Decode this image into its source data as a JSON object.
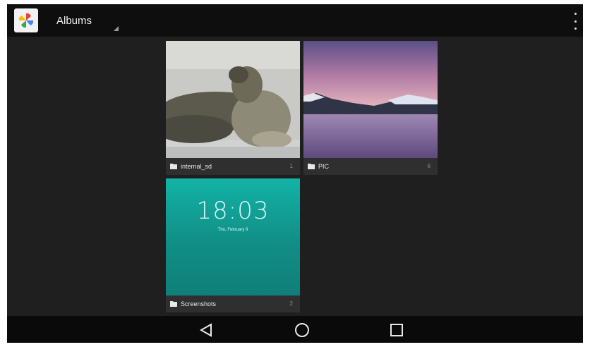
{
  "actionbar": {
    "title": "Albums",
    "app_icon": "photos-pinwheel-icon",
    "menu_icon": "overflow-menu-icon"
  },
  "albums": [
    {
      "name": "internal_sd",
      "count": "1",
      "thumb": "sea-lions-photo"
    },
    {
      "name": "PIC",
      "count": "6",
      "thumb": "lake-sunset-photo"
    },
    {
      "name": "Screenshots",
      "count": "2",
      "thumb": "lockscreen-screenshot",
      "lock_time": "18:03",
      "lock_date": "Thu, February 9"
    }
  ],
  "navbar": {
    "back_icon": "back-triangle-icon",
    "home_icon": "home-circle-icon",
    "recents_icon": "recents-square-icon"
  },
  "colors": {
    "background": "#1f1f1f",
    "actionbar": "#0e0e0e",
    "label_bar": "#2f2f2f",
    "teal": "#1aa39a"
  }
}
